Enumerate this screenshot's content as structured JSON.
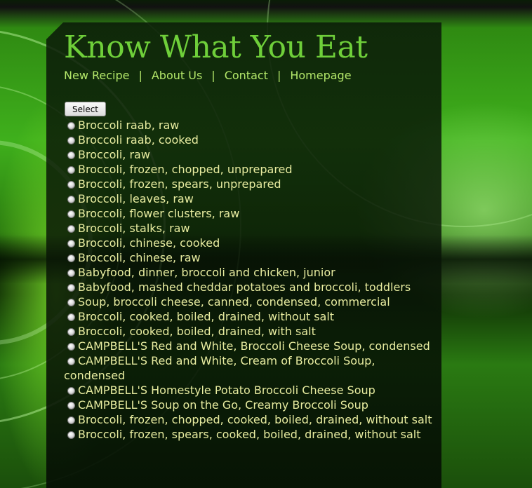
{
  "site": {
    "title": "Know What You Eat"
  },
  "nav": {
    "items": [
      {
        "label": "New Recipe"
      },
      {
        "label": "About Us"
      },
      {
        "label": "Contact"
      },
      {
        "label": "Homepage"
      }
    ],
    "separator": "|"
  },
  "form": {
    "select_label": "Select"
  },
  "foods": [
    "Broccoli raab, raw",
    "Broccoli raab, cooked",
    "Broccoli, raw",
    "Broccoli, frozen, chopped, unprepared",
    "Broccoli, frozen, spears, unprepared",
    "Broccoli, leaves, raw",
    "Broccoli, flower clusters, raw",
    "Broccoli, stalks, raw",
    "Broccoli, chinese, cooked",
    "Broccoli, chinese, raw",
    "Babyfood, dinner, broccoli and chicken, junior",
    "Babyfood, mashed cheddar potatoes and broccoli, toddlers",
    "Soup, broccoli cheese, canned, condensed, commercial",
    "Broccoli, cooked, boiled, drained, without salt",
    "Broccoli, cooked, boiled, drained, with salt",
    "CAMPBELL'S Red and White, Broccoli Cheese Soup, condensed",
    "CAMPBELL'S Red and White, Cream of Broccoli Soup, condensed",
    "CAMPBELL'S Homestyle Potato Broccoli Cheese Soup",
    "CAMPBELL'S Soup on the Go, Creamy Broccoli Soup",
    "Broccoli, frozen, chopped, cooked, boiled, drained, without salt",
    "Broccoli, frozen, spears, cooked, boiled, drained, without salt"
  ],
  "colors": {
    "title": "#6fcf3a",
    "nav": "#b4e86a",
    "list_text": "#e8eca0"
  }
}
